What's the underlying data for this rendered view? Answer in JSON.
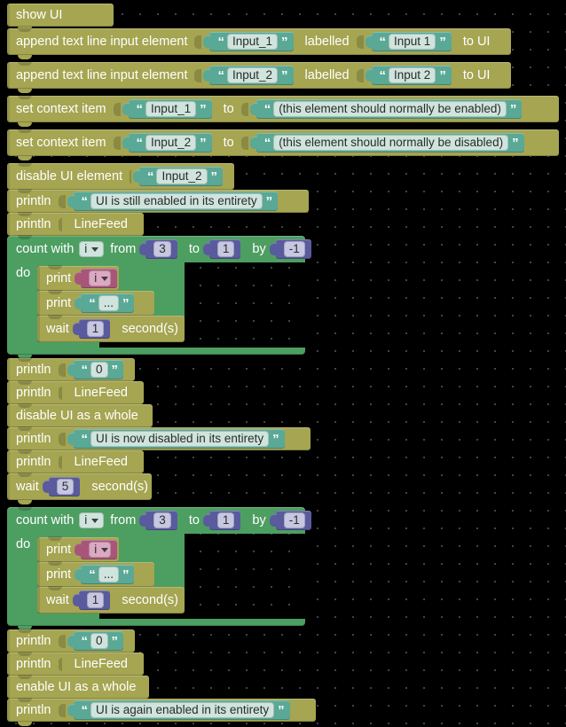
{
  "workspace": {
    "title": "blocks-workspace",
    "background_color": "#000000",
    "grid_dot_color": "#5a5a5a",
    "colors": {
      "statement_olive": "#a5a552",
      "control_green": "#4d9e61",
      "text_teal": "#5aa896",
      "number_blue": "#5a5a9e",
      "variable_pink": "#a9557a",
      "field_light": "#cfe4dc"
    }
  },
  "blocks": {
    "show_ui": {
      "label": "show UI"
    },
    "append_1": {
      "label": "append text line input element",
      "name_value": "Input_1",
      "labelled_label": "labelled",
      "label_value": "Input 1",
      "to_ui_label": "to UI"
    },
    "append_2": {
      "label": "append text line input element",
      "name_value": "Input_2",
      "labelled_label": "labelled",
      "label_value": "Input 2",
      "to_ui_label": "to UI"
    },
    "set_ctx_1": {
      "label": "set context item",
      "key_value": "Input_1",
      "to_label": "to",
      "val_value": "(this element should normally be enabled)"
    },
    "set_ctx_2": {
      "label": "set context item",
      "key_value": "Input_2",
      "to_label": "to",
      "val_value": "(this element should normally be disabled)"
    },
    "disable_el": {
      "label": "disable UI element",
      "value": "Input_2"
    },
    "println_1": {
      "label": "println",
      "value": "UI is still enabled in its entirety"
    },
    "println_lf_1": {
      "label": "println",
      "field": "LineFeed"
    },
    "loop_1": {
      "count_with_label": "count with",
      "var": "i",
      "from_label": "from",
      "from_value": "3",
      "to_label": "to",
      "to_value": "1",
      "by_label": "by",
      "by_value": "-1",
      "do_label": "do",
      "body": {
        "print_var": {
          "label": "print",
          "var": "i"
        },
        "print_dots": {
          "label": "print",
          "value": "..."
        },
        "wait": {
          "label": "wait",
          "value": "1",
          "unit": "second(s)"
        }
      }
    },
    "println_zero_1": {
      "label": "println",
      "value": "0"
    },
    "println_lf_2": {
      "label": "println",
      "field": "LineFeed"
    },
    "disable_whole": {
      "label": "disable UI as a whole"
    },
    "println_2": {
      "label": "println",
      "value": "UI is now disabled in its entirety"
    },
    "println_lf_3": {
      "label": "println",
      "field": "LineFeed"
    },
    "wait_5": {
      "label": "wait",
      "value": "5",
      "unit": "second(s)"
    },
    "loop_2": {
      "count_with_label": "count with",
      "var": "i",
      "from_label": "from",
      "from_value": "3",
      "to_label": "to",
      "to_value": "1",
      "by_label": "by",
      "by_value": "-1",
      "do_label": "do",
      "body": {
        "print_var": {
          "label": "print",
          "var": "i"
        },
        "print_dots": {
          "label": "print",
          "value": "..."
        },
        "wait": {
          "label": "wait",
          "value": "1",
          "unit": "second(s)"
        }
      }
    },
    "println_zero_2": {
      "label": "println",
      "value": "0"
    },
    "println_lf_4": {
      "label": "println",
      "field": "LineFeed"
    },
    "enable_whole": {
      "label": "enable UI as a whole"
    },
    "println_3": {
      "label": "println",
      "value": "UI is again enabled in its entirety"
    }
  },
  "quotes": {
    "open": "“",
    "close": "”"
  }
}
